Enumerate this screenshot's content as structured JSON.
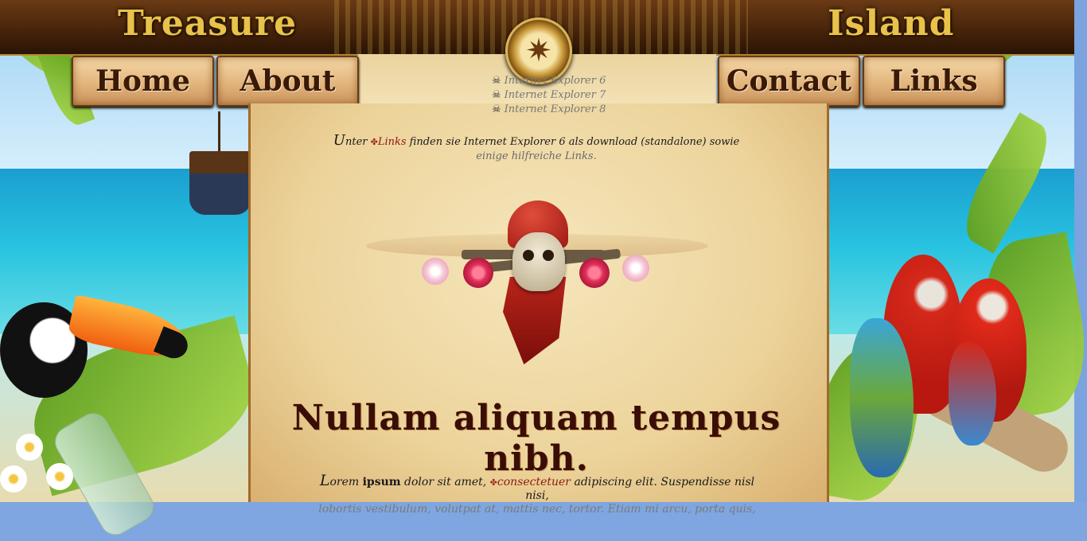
{
  "header": {
    "logo_left": "Treasure",
    "logo_right": "Island"
  },
  "nav": {
    "items": [
      "Home",
      "About",
      "Contact",
      "Links"
    ]
  },
  "ie_list": [
    "Internet Explorer 6",
    "Internet Explorer 7",
    "Internet Explorer 8"
  ],
  "intro": {
    "cap": "U",
    "before_link": "nter ",
    "link": "Links",
    "after_link": " finden sie Internet Explorer 6 als download (standalone) sowie",
    "line2": "einige hilfreiche Links."
  },
  "headline": "Nullam aliquam tempus nibh.",
  "body": {
    "cap": "L",
    "t1": "orem ",
    "bold": "ipsum",
    "t2": " dolor sit amet, ",
    "link": "consectetuer",
    "t3": " adipiscing elit. Suspendisse nisl nisi,",
    "line2": "lobortis vestibulum, volutpat at, mattis nec, tortor. Etiam mi arcu, porta quis,"
  },
  "icons": {
    "ie_bullet": "skull-crossbones-icon",
    "link_bullet": "flower-icon",
    "compass": "compass-icon"
  },
  "colors": {
    "link": "#8a1a10",
    "header_wood": "#3e1f08",
    "gold": "#e8c24a",
    "parchment": "#f0dba8"
  }
}
